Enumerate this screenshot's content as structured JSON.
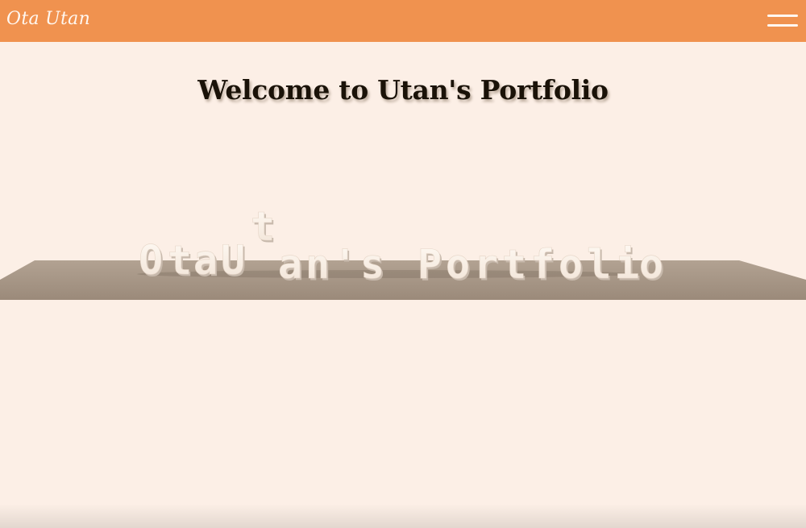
{
  "navbar": {
    "brand": "Ota Utan",
    "menu_icon": "hamburger-menu-icon"
  },
  "header": {
    "title": "Welcome to Utan's Portfolio"
  },
  "scene": {
    "text3d": "OtaUtan's Portfolio",
    "colors": {
      "floor": "#a39181",
      "letter": "#fdf6ee",
      "letter_side": "#c7b9ac",
      "shadow": "#6b5c50"
    }
  },
  "colors": {
    "navbar": "#f0924f",
    "background": "#fcefe6"
  }
}
